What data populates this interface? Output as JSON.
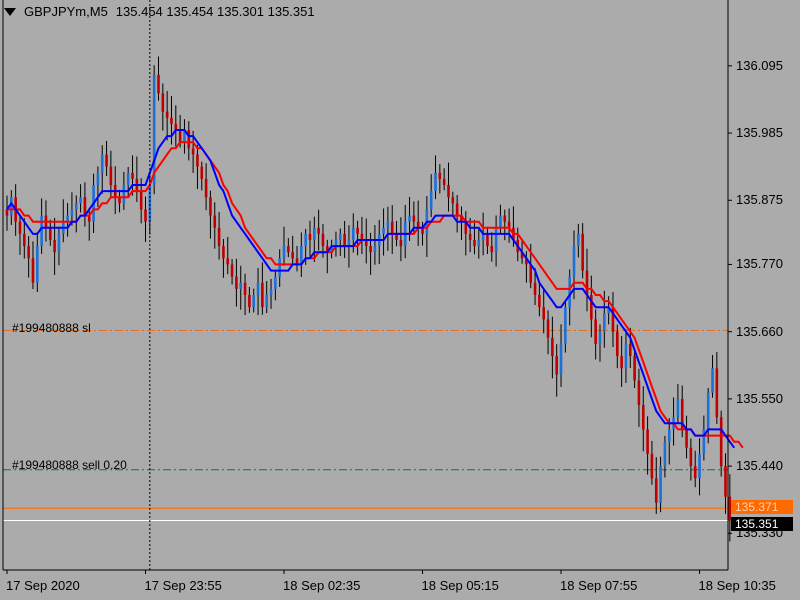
{
  "header": {
    "symbol_tf": "GBPJPYm,M5",
    "ohlc": "135.454 135.454 135.301 135.351"
  },
  "colors": {
    "background": "#ababab",
    "grid_line": "#000000",
    "bull_candle": "#1e6fd6",
    "bear_candle": "#c00000",
    "wick": "#000000",
    "ma_fast": "#0000ff",
    "ma_slow": "#ff0000",
    "sl_line": "#e07020",
    "entry_line": "#1a7a1a",
    "price_line": "#ff6a00",
    "bid_line": "#ffffff",
    "price_box_orange": "#ff6a00",
    "price_box_black": "#000000"
  },
  "annotations": {
    "sl_label": "#199480888 sl",
    "sell_label": "#199480888 sell 0.20"
  },
  "price_labels": {
    "ask": "135.371",
    "bid": "135.351"
  },
  "chart_data": {
    "type": "candlestick",
    "title": "GBPJPYm,M5",
    "ylim": [
      135.27,
      136.17
    ],
    "y_ticks": [
      136.095,
      135.985,
      135.875,
      135.77,
      135.66,
      135.55,
      135.44,
      135.33
    ],
    "x_tick_labels": [
      "17 Sep 2020",
      "17 Sep 23:55",
      "18 Sep 02:35",
      "18 Sep 05:15",
      "18 Sep 07:55",
      "18 Sep 10:35"
    ],
    "x_tick_candle_index": [
      0,
      32,
      64,
      96,
      128,
      160
    ],
    "levels": {
      "stop_loss": 135.662,
      "sell_entry": 135.434,
      "ask": 135.371,
      "bid": 135.351,
      "cursor_candle_index": 33
    },
    "closes": [
      135.85,
      135.88,
      135.84,
      135.82,
      135.8,
      135.78,
      135.74,
      135.8,
      135.85,
      135.83,
      135.81,
      135.79,
      135.82,
      135.84,
      135.85,
      135.86,
      135.87,
      135.88,
      135.85,
      135.84,
      135.9,
      135.92,
      135.95,
      135.93,
      135.9,
      135.88,
      135.87,
      135.9,
      135.92,
      135.91,
      135.89,
      135.86,
      135.84,
      135.9,
      136.08,
      136.05,
      136.02,
      136.01,
      136.0,
      135.99,
      135.97,
      135.99,
      135.96,
      135.95,
      135.93,
      135.91,
      135.88,
      135.85,
      135.83,
      135.8,
      135.78,
      135.77,
      135.75,
      135.73,
      135.74,
      135.72,
      135.7,
      135.72,
      135.74,
      135.7,
      135.72,
      135.73,
      135.75,
      135.78,
      135.8,
      135.79,
      135.78,
      135.77,
      135.8,
      135.82,
      135.81,
      135.83,
      135.82,
      135.8,
      135.79,
      135.8,
      135.81,
      135.82,
      135.8,
      135.81,
      135.83,
      135.82,
      135.81,
      135.8,
      135.79,
      135.8,
      135.82,
      135.83,
      135.84,
      135.82,
      135.81,
      135.8,
      135.84,
      135.85,
      135.84,
      135.83,
      135.82,
      135.86,
      135.89,
      135.92,
      135.91,
      135.9,
      135.88,
      135.87,
      135.85,
      135.84,
      135.82,
      135.81,
      135.8,
      135.81,
      135.82,
      135.8,
      135.79,
      135.83,
      135.85,
      135.84,
      135.83,
      135.81,
      135.79,
      135.78,
      135.77,
      135.74,
      135.72,
      135.7,
      135.68,
      135.65,
      135.62,
      135.59,
      135.64,
      135.7,
      135.75,
      135.8,
      135.82,
      135.76,
      135.72,
      135.68,
      135.64,
      135.66,
      135.69,
      135.7,
      135.66,
      135.62,
      135.6,
      135.64,
      135.62,
      135.58,
      135.54,
      135.5,
      135.46,
      135.42,
      135.38,
      135.44,
      135.48,
      135.5,
      135.52,
      135.55,
      135.5,
      135.47,
      135.44,
      135.42,
      135.46,
      135.5,
      135.56,
      135.6,
      135.52,
      135.44,
      135.39,
      135.351
    ],
    "ma_fast": [
      135.86,
      135.87,
      135.86,
      135.85,
      135.84,
      135.83,
      135.82,
      135.82,
      135.83,
      135.83,
      135.83,
      135.83,
      135.83,
      135.83,
      135.83,
      135.84,
      135.84,
      135.85,
      135.85,
      135.86,
      135.87,
      135.88,
      135.89,
      135.89,
      135.89,
      135.89,
      135.89,
      135.89,
      135.89,
      135.9,
      135.9,
      135.9,
      135.9,
      135.92,
      135.94,
      135.96,
      135.97,
      135.98,
      135.98,
      135.99,
      135.99,
      135.99,
      135.98,
      135.98,
      135.97,
      135.96,
      135.95,
      135.94,
      135.92,
      135.9,
      135.89,
      135.87,
      135.85,
      135.84,
      135.83,
      135.82,
      135.81,
      135.8,
      135.79,
      135.78,
      135.77,
      135.76,
      135.76,
      135.76,
      135.76,
      135.76,
      135.77,
      135.77,
      135.77,
      135.78,
      135.78,
      135.79,
      135.79,
      135.79,
      135.79,
      135.8,
      135.8,
      135.8,
      135.8,
      135.8,
      135.8,
      135.81,
      135.81,
      135.81,
      135.81,
      135.81,
      135.81,
      135.81,
      135.82,
      135.82,
      135.82,
      135.82,
      135.82,
      135.82,
      135.83,
      135.83,
      135.83,
      135.84,
      135.84,
      135.85,
      135.85,
      135.85,
      135.85,
      135.85,
      135.84,
      135.84,
      135.84,
      135.83,
      135.83,
      135.83,
      135.82,
      135.82,
      135.82,
      135.82,
      135.82,
      135.82,
      135.82,
      135.81,
      135.8,
      135.79,
      135.78,
      135.77,
      135.76,
      135.74,
      135.73,
      135.72,
      135.71,
      135.7,
      135.7,
      135.71,
      135.72,
      135.73,
      135.73,
      135.73,
      135.72,
      135.71,
      135.7,
      135.7,
      135.7,
      135.7,
      135.69,
      135.68,
      135.67,
      135.66,
      135.65,
      135.63,
      135.61,
      135.59,
      135.57,
      135.55,
      135.53,
      135.52,
      135.51,
      135.51,
      135.51,
      135.51,
      135.51,
      135.5,
      135.5,
      135.49,
      135.49,
      135.49,
      135.5,
      135.5,
      135.5,
      135.5,
      135.49,
      135.48,
      135.47
    ],
    "ma_slow": [
      135.86,
      135.86,
      135.86,
      135.86,
      135.85,
      135.85,
      135.84,
      135.84,
      135.84,
      135.84,
      135.84,
      135.84,
      135.84,
      135.84,
      135.84,
      135.84,
      135.84,
      135.85,
      135.85,
      135.85,
      135.86,
      135.86,
      135.87,
      135.87,
      135.88,
      135.88,
      135.88,
      135.88,
      135.88,
      135.89,
      135.89,
      135.89,
      135.89,
      135.9,
      135.92,
      135.93,
      135.94,
      135.95,
      135.96,
      135.96,
      135.97,
      135.97,
      135.97,
      135.97,
      135.96,
      135.96,
      135.95,
      135.94,
      135.93,
      135.92,
      135.9,
      135.89,
      135.87,
      135.86,
      135.85,
      135.83,
      135.82,
      135.81,
      135.8,
      135.79,
      135.78,
      135.78,
      135.77,
      135.77,
      135.77,
      135.77,
      135.77,
      135.77,
      135.77,
      135.78,
      135.78,
      135.78,
      135.79,
      135.79,
      135.79,
      135.79,
      135.8,
      135.8,
      135.8,
      135.8,
      135.8,
      135.8,
      135.81,
      135.81,
      135.81,
      135.81,
      135.81,
      135.81,
      135.82,
      135.82,
      135.82,
      135.82,
      135.82,
      135.82,
      135.82,
      135.83,
      135.83,
      135.83,
      135.84,
      135.84,
      135.84,
      135.85,
      135.85,
      135.85,
      135.85,
      135.85,
      135.84,
      135.84,
      135.84,
      135.84,
      135.83,
      135.83,
      135.83,
      135.83,
      135.83,
      135.83,
      135.83,
      135.82,
      135.82,
      135.81,
      135.8,
      135.79,
      135.78,
      135.77,
      135.76,
      135.75,
      135.74,
      135.73,
      135.73,
      135.73,
      135.73,
      135.74,
      135.74,
      135.74,
      135.73,
      135.73,
      135.72,
      135.72,
      135.71,
      135.71,
      135.7,
      135.69,
      135.68,
      135.67,
      135.66,
      135.65,
      135.63,
      135.61,
      135.59,
      135.57,
      135.55,
      135.53,
      135.52,
      135.51,
      135.51,
      135.5,
      135.5,
      135.5,
      135.5,
      135.49,
      135.49,
      135.49,
      135.49,
      135.49,
      135.49,
      135.49,
      135.49,
      135.49,
      135.48,
      135.48,
      135.47
    ]
  }
}
